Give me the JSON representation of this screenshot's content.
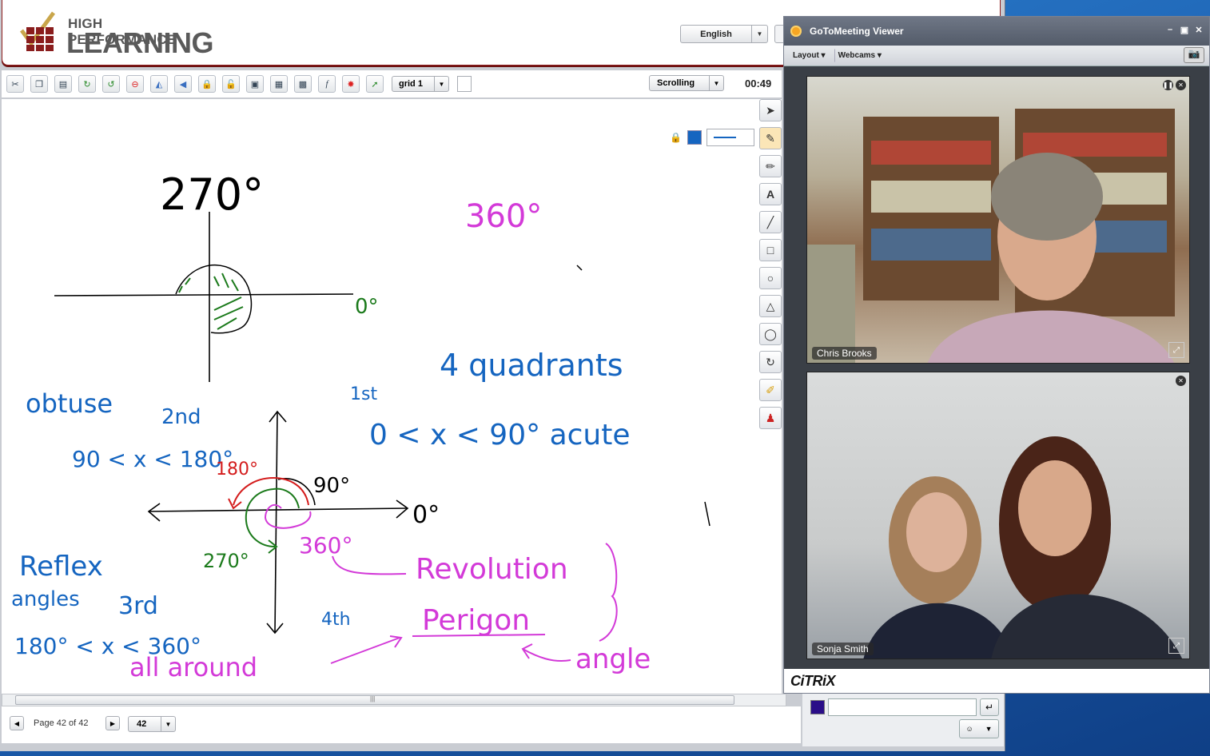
{
  "app": {
    "logo_top": "HIGH PERFORMANCE",
    "logo_bottom": "LEARNING",
    "language": "English"
  },
  "toolbar": {
    "icons": [
      "scissors-icon",
      "copy-icon",
      "paste-icon",
      "redo-icon",
      "refresh-icon",
      "stop-icon",
      "mirror-icon",
      "arrow-left-icon",
      "lock-icon",
      "lock-all-icon",
      "page-icon",
      "page-copy-icon",
      "screen-capture-icon",
      "formula-icon",
      "shapes-icon",
      "select-green-icon"
    ],
    "grid_value": "grid 1",
    "scroll_mode": "Scrolling",
    "timer": "00:49"
  },
  "right_tools": [
    "select-icon",
    "pen-icon",
    "pencil-icon",
    "text-icon",
    "line-icon",
    "rectangle-icon",
    "circle-icon",
    "triangle-icon",
    "ellipse-icon",
    "rotate-icon",
    "highlighter-icon",
    "stamp-icon"
  ],
  "pen": {
    "color": "#1565c0"
  },
  "whiteboard": {
    "t270": "270°",
    "t0top": "0°",
    "t360top": "360°",
    "quadrants": "4 quadrants",
    "first": "1st",
    "acute": "0 < x < 90° acute",
    "obtuse": "obtuse",
    "second": "2nd",
    "obtuse_range": "90 < x < 180°",
    "t180": "180°",
    "t90": "90°",
    "t0right": "0°",
    "t270b": "270°",
    "t360b": "360°",
    "reflex": "Reflex",
    "angles": "angles",
    "third": "3rd",
    "reflex_range": "180° < x < 360°",
    "fourth": "4th",
    "revolution": "Revolution",
    "perigon": "Perigon",
    "angle": "angle",
    "all_around": "all around"
  },
  "footer": {
    "page_label": "Page 42 of 42",
    "page_value": "42"
  },
  "viewer": {
    "title": "GoToMeeting Viewer",
    "menu_layout": "Layout",
    "menu_webcams": "Webcams",
    "cam1_name": "Chris Brooks",
    "cam2_name": "Sonja Smith",
    "brand": "CiTRiX",
    "chat_color": "#2a0e88"
  }
}
